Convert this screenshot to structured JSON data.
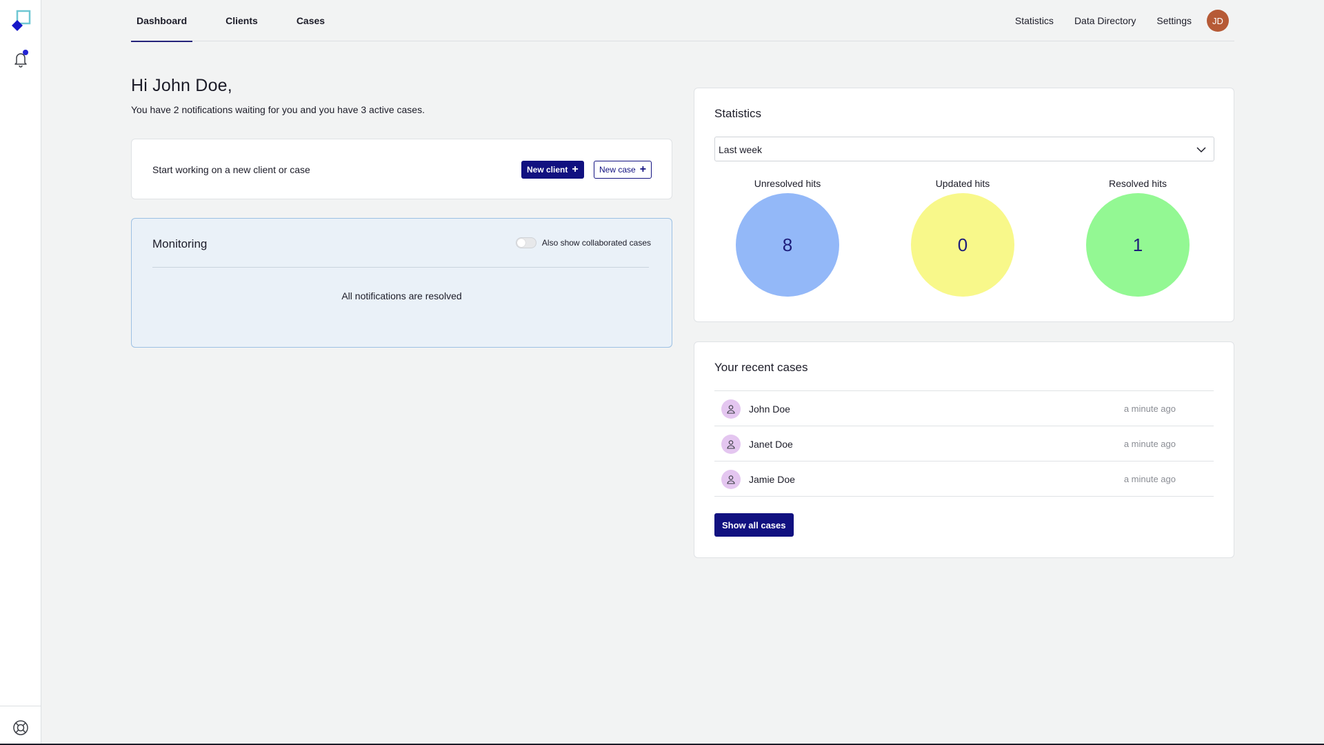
{
  "nav": {
    "tabs": [
      {
        "label": "Dashboard",
        "active": true
      },
      {
        "label": "Clients",
        "active": false
      },
      {
        "label": "Cases",
        "active": false
      }
    ],
    "right_links": [
      "Statistics",
      "Data Directory",
      "Settings"
    ],
    "avatar_initials": "JD"
  },
  "rail": {
    "logo_icon": "app-logo-icon",
    "notification_icon": "bell-icon",
    "help_icon": "lifebuoy-icon"
  },
  "greeting": {
    "title": "Hi John Doe,",
    "subtitle": "You have 2 notifications waiting for you and you have 3 active cases."
  },
  "start_card": {
    "text": "Start working on a new client or case",
    "new_client_label": "New client",
    "new_case_label": "New case",
    "plus": "+"
  },
  "monitoring": {
    "title": "Monitoring",
    "toggle_label": "Also show collaborated cases",
    "toggle_on": false,
    "empty_message": "All notifications are resolved"
  },
  "statistics": {
    "title": "Statistics",
    "period": "Last week",
    "items": [
      {
        "label": "Unresolved hits",
        "value": "8",
        "color": "#93b8f8"
      },
      {
        "label": "Updated hits",
        "value": "0",
        "color": "#f8f88a"
      },
      {
        "label": "Resolved hits",
        "value": "1",
        "color": "#93f893"
      }
    ]
  },
  "recent_cases": {
    "title": "Your recent cases",
    "items": [
      {
        "name": "John Doe",
        "time": "a minute ago"
      },
      {
        "name": "Janet Doe",
        "time": "a minute ago"
      },
      {
        "name": "Jamie Doe",
        "time": "a minute ago"
      }
    ],
    "show_all_label": "Show all cases"
  },
  "colors": {
    "primary": "#111180",
    "avatar": "#b65a36",
    "case_avatar": "#e4c6f0",
    "monitoring_bg": "#eaf1f8",
    "monitoring_border": "#9cc0e3"
  }
}
